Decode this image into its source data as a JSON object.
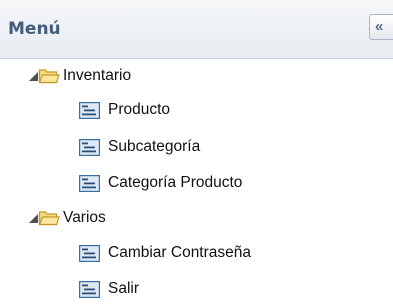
{
  "panel": {
    "title": "Menú",
    "collapse_glyph": "«"
  },
  "tree": {
    "groups": [
      {
        "label": "Inventario",
        "icon": "folder-open-icon",
        "expanded": true,
        "items": [
          {
            "label": "Producto",
            "icon": "form-icon"
          },
          {
            "label": "Subcategoría",
            "icon": "form-icon"
          },
          {
            "label": "Categoría Producto",
            "icon": "form-icon"
          }
        ]
      },
      {
        "label": "Varios",
        "icon": "folder-open-icon",
        "expanded": true,
        "items": [
          {
            "label": "Cambiar Contraseña",
            "icon": "form-icon"
          },
          {
            "label": "Salir",
            "icon": "form-icon"
          }
        ]
      }
    ]
  },
  "colors": {
    "header_title": "#415d7b",
    "folder_fill": "#f7dc7a",
    "folder_stroke": "#c5942a",
    "form_icon_fill": "#dde9f5",
    "form_icon_stroke": "#3b6ea3"
  }
}
